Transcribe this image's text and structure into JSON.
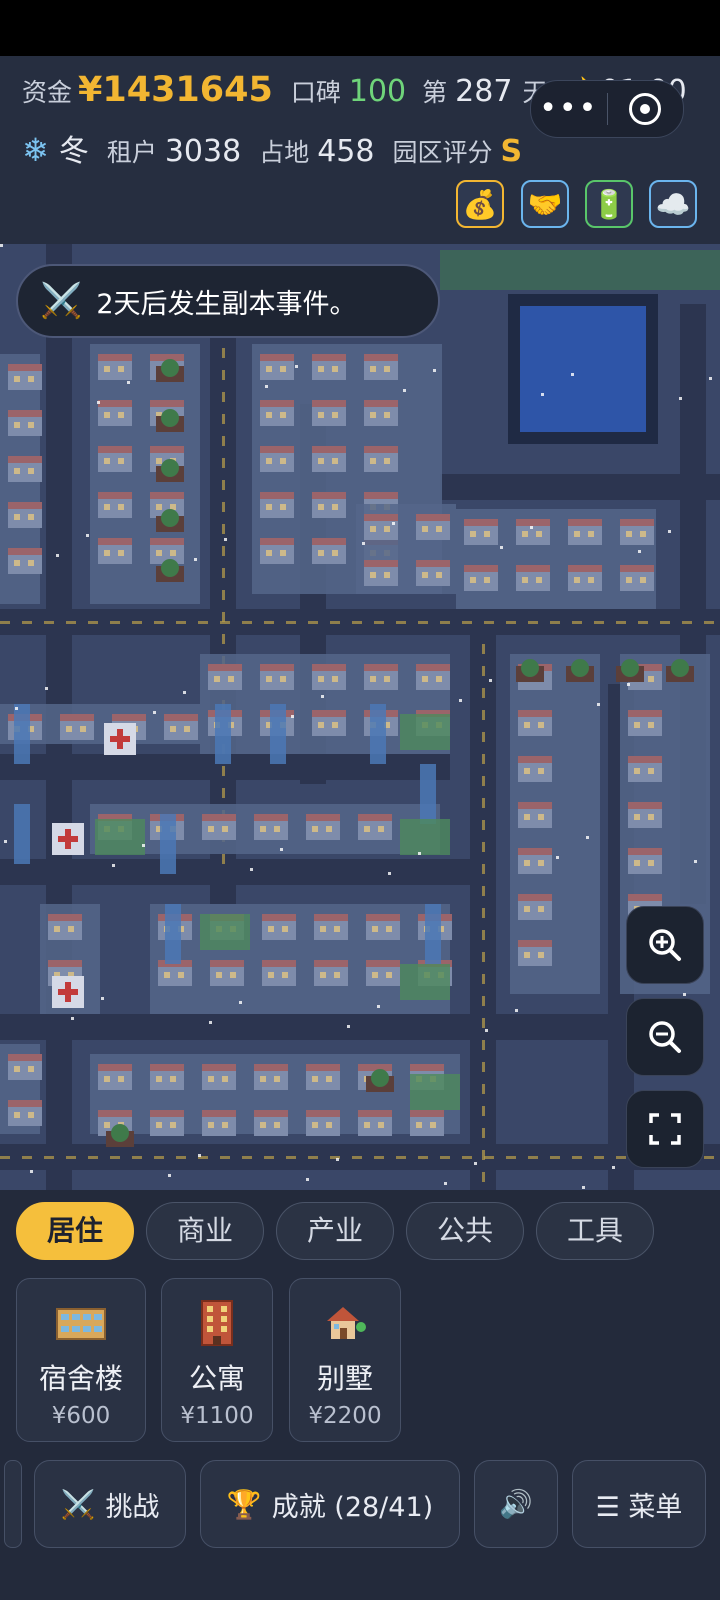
{
  "hud": {
    "funds_label": "资金",
    "funds_value": "¥1431645",
    "reputation_label": "口碑",
    "reputation_value": "100",
    "day_prefix": "第",
    "day_value": "287",
    "day_suffix": "天",
    "moon_icon": "🌙",
    "time": "01:00",
    "snow_icon": "❄",
    "season": "冬",
    "tenants_label": "租户",
    "tenants_value": "3038",
    "land_label": "占地",
    "land_value": "458",
    "rating_label": "园区评分",
    "rating_value": "S"
  },
  "capsule": {
    "more": "•••"
  },
  "quick_buttons": [
    {
      "name": "money-bag-icon",
      "glyph": "💰",
      "border": "#f2b632"
    },
    {
      "name": "handshake-icon",
      "glyph": "🤝",
      "border": "#6bb5ee"
    },
    {
      "name": "battery-icon",
      "glyph": "🔋",
      "border": "#59c66a"
    },
    {
      "name": "cloud-icon",
      "glyph": "☁️",
      "border": "#6bb5ee"
    }
  ],
  "toast": {
    "icon": "⚔️",
    "text": "2天后发生副本事件。"
  },
  "tabs": [
    "居住",
    "商业",
    "产业",
    "公共",
    "工具"
  ],
  "active_tab": 0,
  "buildings": [
    {
      "name": "宿舍楼",
      "price": "¥600"
    },
    {
      "name": "公寓",
      "price": "¥1100"
    },
    {
      "name": "别墅",
      "price": "¥2200"
    }
  ],
  "actions": {
    "challenge_icon": "⚔️",
    "challenge": "挑战",
    "achievement_icon": "🏆",
    "achievement": "成就 (28/41)",
    "sound_icon": "🔊",
    "menu": "☰ 菜单"
  },
  "colors": {
    "accent": "#f5bf3c",
    "funds": "#f2b632",
    "reputation": "#6fd47a",
    "background": "#232a3b"
  }
}
